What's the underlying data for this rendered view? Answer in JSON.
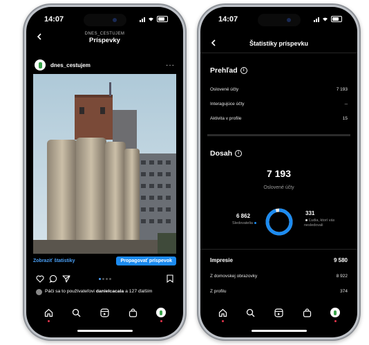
{
  "left_phone": {
    "status_time": "14:07",
    "nav_sub": "DNES_CESTUJEM",
    "nav_title": "Príspevky",
    "username": "dnes_cestujem",
    "more_icon": "more-icon",
    "stats_link": "Zobraziť štatistiky",
    "promote_button": "Propagovať príspevok",
    "likes_prefix": "Páči sa to používateľovi ",
    "likes_user": "danielcacala",
    "likes_suffix": " a 127 ďalším",
    "colors": {
      "accent": "#1c8bf0",
      "link": "#4a9ff5"
    }
  },
  "right_phone": {
    "status_time": "14:07",
    "nav_title": "Štatistiky príspevku",
    "overview": {
      "title": "Prehľad",
      "rows": [
        {
          "label": "Oslovené účty",
          "value": "7 193"
        },
        {
          "label": "Interagujúce účty",
          "value": "--"
        },
        {
          "label": "Aktivita v profile",
          "value": "15"
        }
      ]
    },
    "reach": {
      "title": "Dosah",
      "total": "7 193",
      "total_label": "Oslovené účty",
      "followers_value": "6 862",
      "followers_label": "Sledovatelia",
      "followers_fraction": 0.954,
      "nonfollowers_value": "331",
      "nonfollowers_label": "Ľudia, ktorí vás nesledovali"
    },
    "impressions": {
      "title": "Impresie",
      "total": "9 580",
      "rows": [
        {
          "label": "Z domovskej obrazovky",
          "value": "8 922"
        },
        {
          "label": "Z profilu",
          "value": "374"
        }
      ]
    }
  }
}
